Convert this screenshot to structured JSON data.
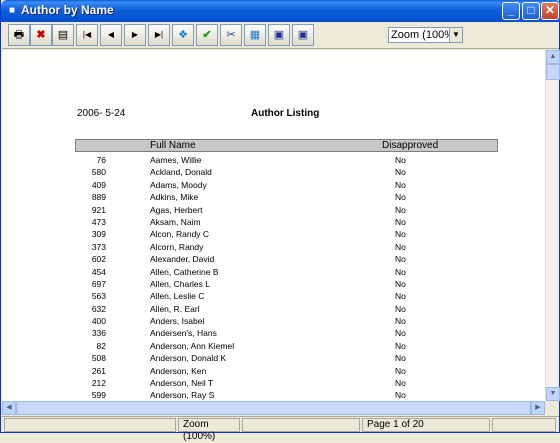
{
  "window": {
    "title": "Author by Name"
  },
  "toolbar": {
    "zoom_value": "Zoom (100%)"
  },
  "report": {
    "date": "2006- 5-24",
    "title": "Author Listing",
    "columns": {
      "full_name": "Full Name",
      "disapproved": "Disapproved"
    },
    "rows": [
      {
        "id": "76",
        "name": "Aames, Willie",
        "disapproved": "No"
      },
      {
        "id": "580",
        "name": "Ackland, Donald",
        "disapproved": "No"
      },
      {
        "id": "409",
        "name": "Adams, Moody",
        "disapproved": "No"
      },
      {
        "id": "889",
        "name": "Adkins, Mike",
        "disapproved": "No"
      },
      {
        "id": "921",
        "name": "Agas, Herbert",
        "disapproved": "No"
      },
      {
        "id": "473",
        "name": "Aksam, Naim",
        "disapproved": "No"
      },
      {
        "id": "309",
        "name": "Alcon, Randy C",
        "disapproved": "No"
      },
      {
        "id": "373",
        "name": "Alcorn, Randy",
        "disapproved": "No"
      },
      {
        "id": "602",
        "name": "Alexander, David",
        "disapproved": "No"
      },
      {
        "id": "454",
        "name": "Allen, Catherine B",
        "disapproved": "No"
      },
      {
        "id": "697",
        "name": "Allen, Charles L",
        "disapproved": "No"
      },
      {
        "id": "563",
        "name": "Allen, Leslie C",
        "disapproved": "No"
      },
      {
        "id": "632",
        "name": "Allen, R. Earl",
        "disapproved": "No"
      },
      {
        "id": "400",
        "name": "Anders, Isabel",
        "disapproved": "No"
      },
      {
        "id": "336",
        "name": "Andersen's, Hans",
        "disapproved": "No"
      },
      {
        "id": "82",
        "name": "Anderson, Ann Kiemel",
        "disapproved": "No"
      },
      {
        "id": "508",
        "name": "Anderson, Donald K",
        "disapproved": "No"
      },
      {
        "id": "261",
        "name": "Anderson, Ken",
        "disapproved": "No"
      },
      {
        "id": "212",
        "name": "Anderson, Neil T",
        "disapproved": "No"
      },
      {
        "id": "599",
        "name": "Anderson, Ray S",
        "disapproved": "No"
      }
    ]
  },
  "status": {
    "zoom": "Zoom (100%)",
    "page": "Page 1 of 20"
  }
}
